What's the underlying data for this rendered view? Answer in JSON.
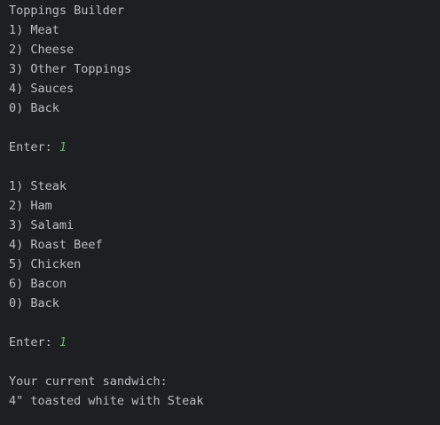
{
  "console": {
    "menu_title": "Toppings Builder",
    "menu_options": [
      "1) Meat",
      "2) Cheese",
      "3) Other Toppings",
      "4) Sauces",
      "0) Back"
    ],
    "prompt_1_label": "Enter: ",
    "prompt_1_value": "1",
    "meat_options": [
      "1) Steak",
      "2) Ham",
      "3) Salami",
      "4) Roast Beef",
      "5) Chicken",
      "6) Bacon",
      "0) Back"
    ],
    "prompt_2_label": "Enter: ",
    "prompt_2_value": "1",
    "sandwich_heading": "Your current sandwich:",
    "sandwich_summary": "4\" toasted white with Steak"
  },
  "colors": {
    "background": "#1e1f22",
    "text": "#bcbec4",
    "user_input": "#5fb865"
  }
}
